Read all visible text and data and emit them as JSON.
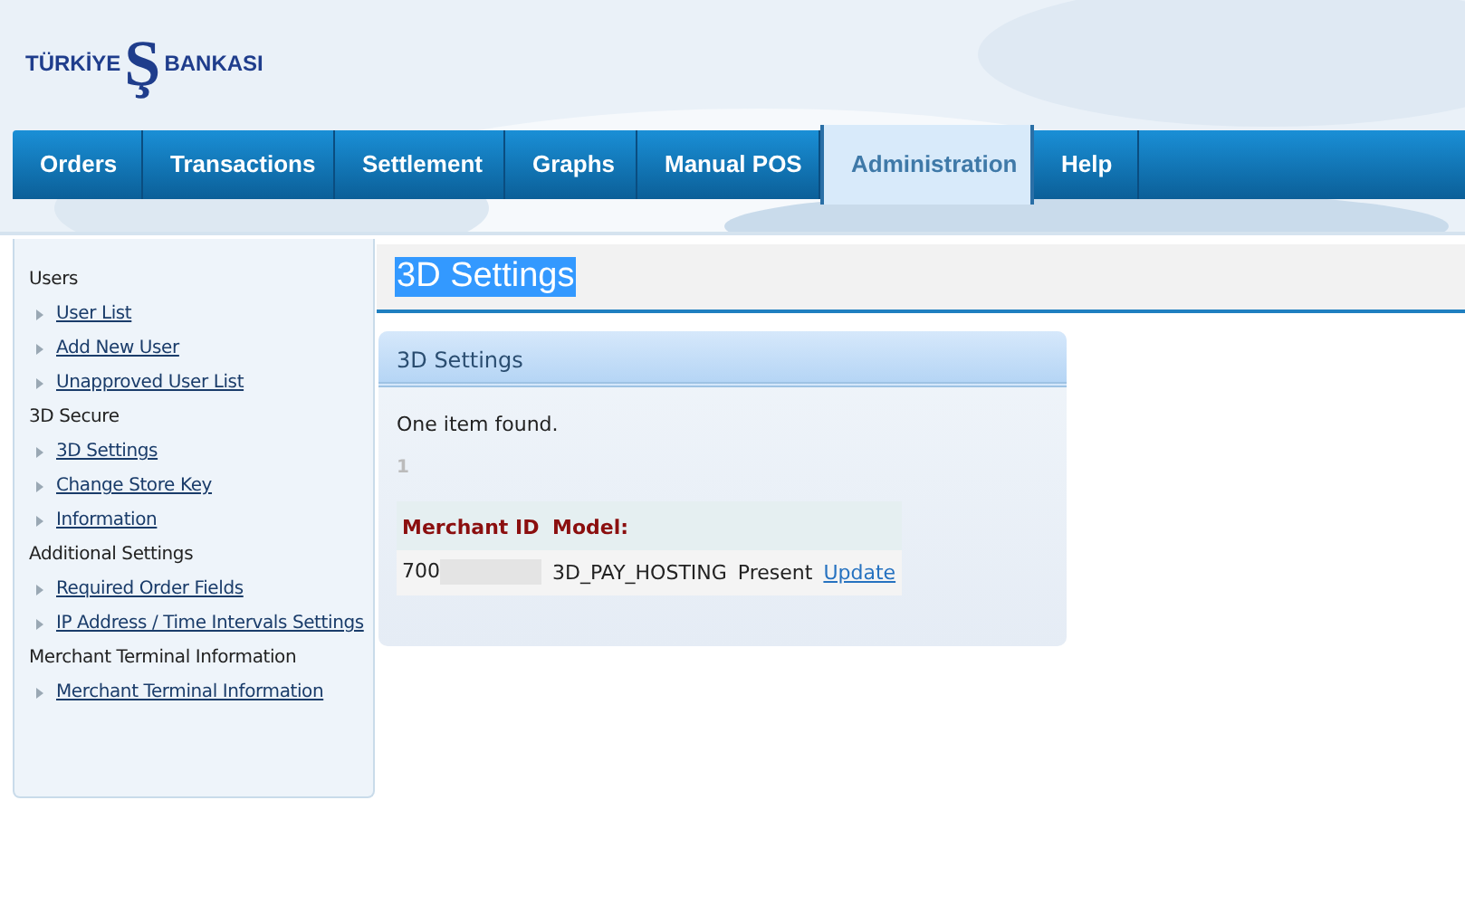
{
  "logo": {
    "left": "TÜRKİYE",
    "mark": "Ş",
    "right": "BANKASI"
  },
  "tabs": [
    {
      "label": "Orders",
      "selected": false
    },
    {
      "label": "Transactions",
      "selected": false
    },
    {
      "label": "Settlement",
      "selected": false
    },
    {
      "label": "Graphs",
      "selected": false
    },
    {
      "label": "Manual POS",
      "selected": false
    },
    {
      "label": "Administration",
      "selected": true
    },
    {
      "label": "Help",
      "selected": false
    }
  ],
  "sidebar": {
    "sections": [
      {
        "title": "Users",
        "items": [
          {
            "label": "User List"
          },
          {
            "label": "Add New User"
          },
          {
            "label": "Unapproved User List"
          }
        ]
      },
      {
        "title": "3D Secure",
        "items": [
          {
            "label": "3D Settings"
          },
          {
            "label": "Change Store Key"
          },
          {
            "label": "Information"
          }
        ]
      },
      {
        "title": "Additional Settings",
        "items": [
          {
            "label": "Required Order Fields"
          },
          {
            "label": "IP Address / Time Intervals Settings"
          }
        ]
      },
      {
        "title": "Merchant Terminal Information",
        "items": [
          {
            "label": "Merchant Terminal Information"
          }
        ]
      }
    ]
  },
  "page_title": {
    "text": "3D Settings",
    "highlighted": true
  },
  "panel": {
    "title": "3D Settings",
    "message": "One item found.",
    "pagination": [
      "1"
    ],
    "table": {
      "columns": [
        "Merchant ID",
        "Model:"
      ],
      "rows": [
        {
          "merchant_id": "700",
          "merchant_id_redacted": true,
          "model": "3D_PAY_HOSTING",
          "status": "Present",
          "action": "Update"
        }
      ]
    }
  }
}
